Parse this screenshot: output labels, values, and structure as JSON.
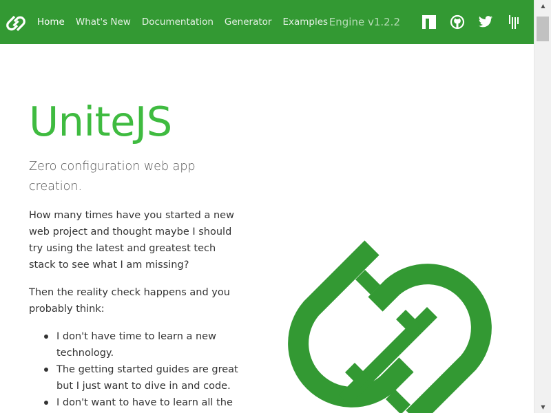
{
  "navbar": {
    "background": "#339933",
    "logo_icon": "chain-link-logo",
    "links": [
      "Home",
      "What's New",
      "Documentation",
      "Generator",
      "Examples"
    ],
    "active_link": "Home",
    "version": "Engine v1.2.2",
    "icons": [
      "npm-icon",
      "github-icon",
      "twitter-icon",
      "gitter-icon"
    ]
  },
  "hero": {
    "title": "UniteJS",
    "title_color": "#3fbb40",
    "subtitle": "Zero configuration web app creation.",
    "para1": "How many times have you started a new web project and thought maybe I should try using the latest and greatest tech stack to see what I am missing?",
    "para2": "Then the reality check happens and you probably think:",
    "bullets": [
      "I don't have time to learn a new technology.",
      "The getting started guides are great but I just want to dive in and code.",
      "I don't want to have to learn all the"
    ],
    "illustration": "chain-link-logo",
    "logo_color": "#339933"
  }
}
